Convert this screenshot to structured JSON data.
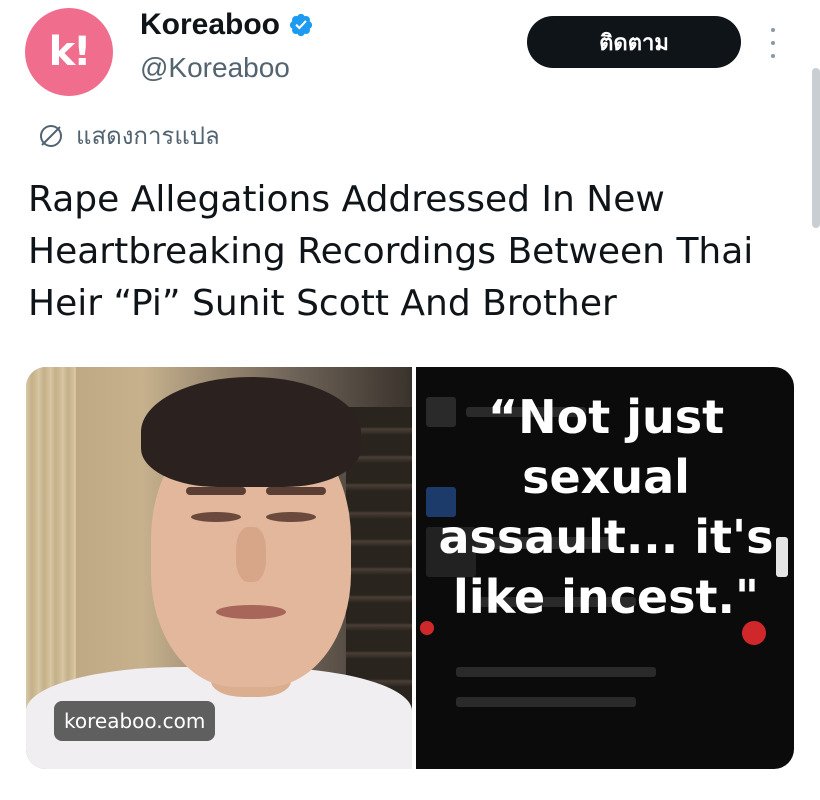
{
  "account": {
    "display_name": "Koreaboo",
    "handle": "@Koreaboo",
    "avatar_letter": "k!",
    "verified": true
  },
  "actions": {
    "follow_label": "ติดตาม"
  },
  "translate": {
    "label": "แสดงการแปล"
  },
  "tweet": {
    "text": "Rape Allegations Addressed In New Heartbreaking Recordings Between Thai Heir “Pi” Sunit Scott And Brother"
  },
  "media": {
    "watermark": "koreaboo.com",
    "quote": "“Not just sexual assault... it's like incest.\""
  },
  "colors": {
    "avatar_bg": "#f06d8e",
    "verified": "#1d9bf0",
    "button_bg": "#0f1419",
    "secondary_text": "#536471"
  },
  "icons": [
    "verified-badge-icon",
    "more-options-icon",
    "translate-globe-icon"
  ]
}
